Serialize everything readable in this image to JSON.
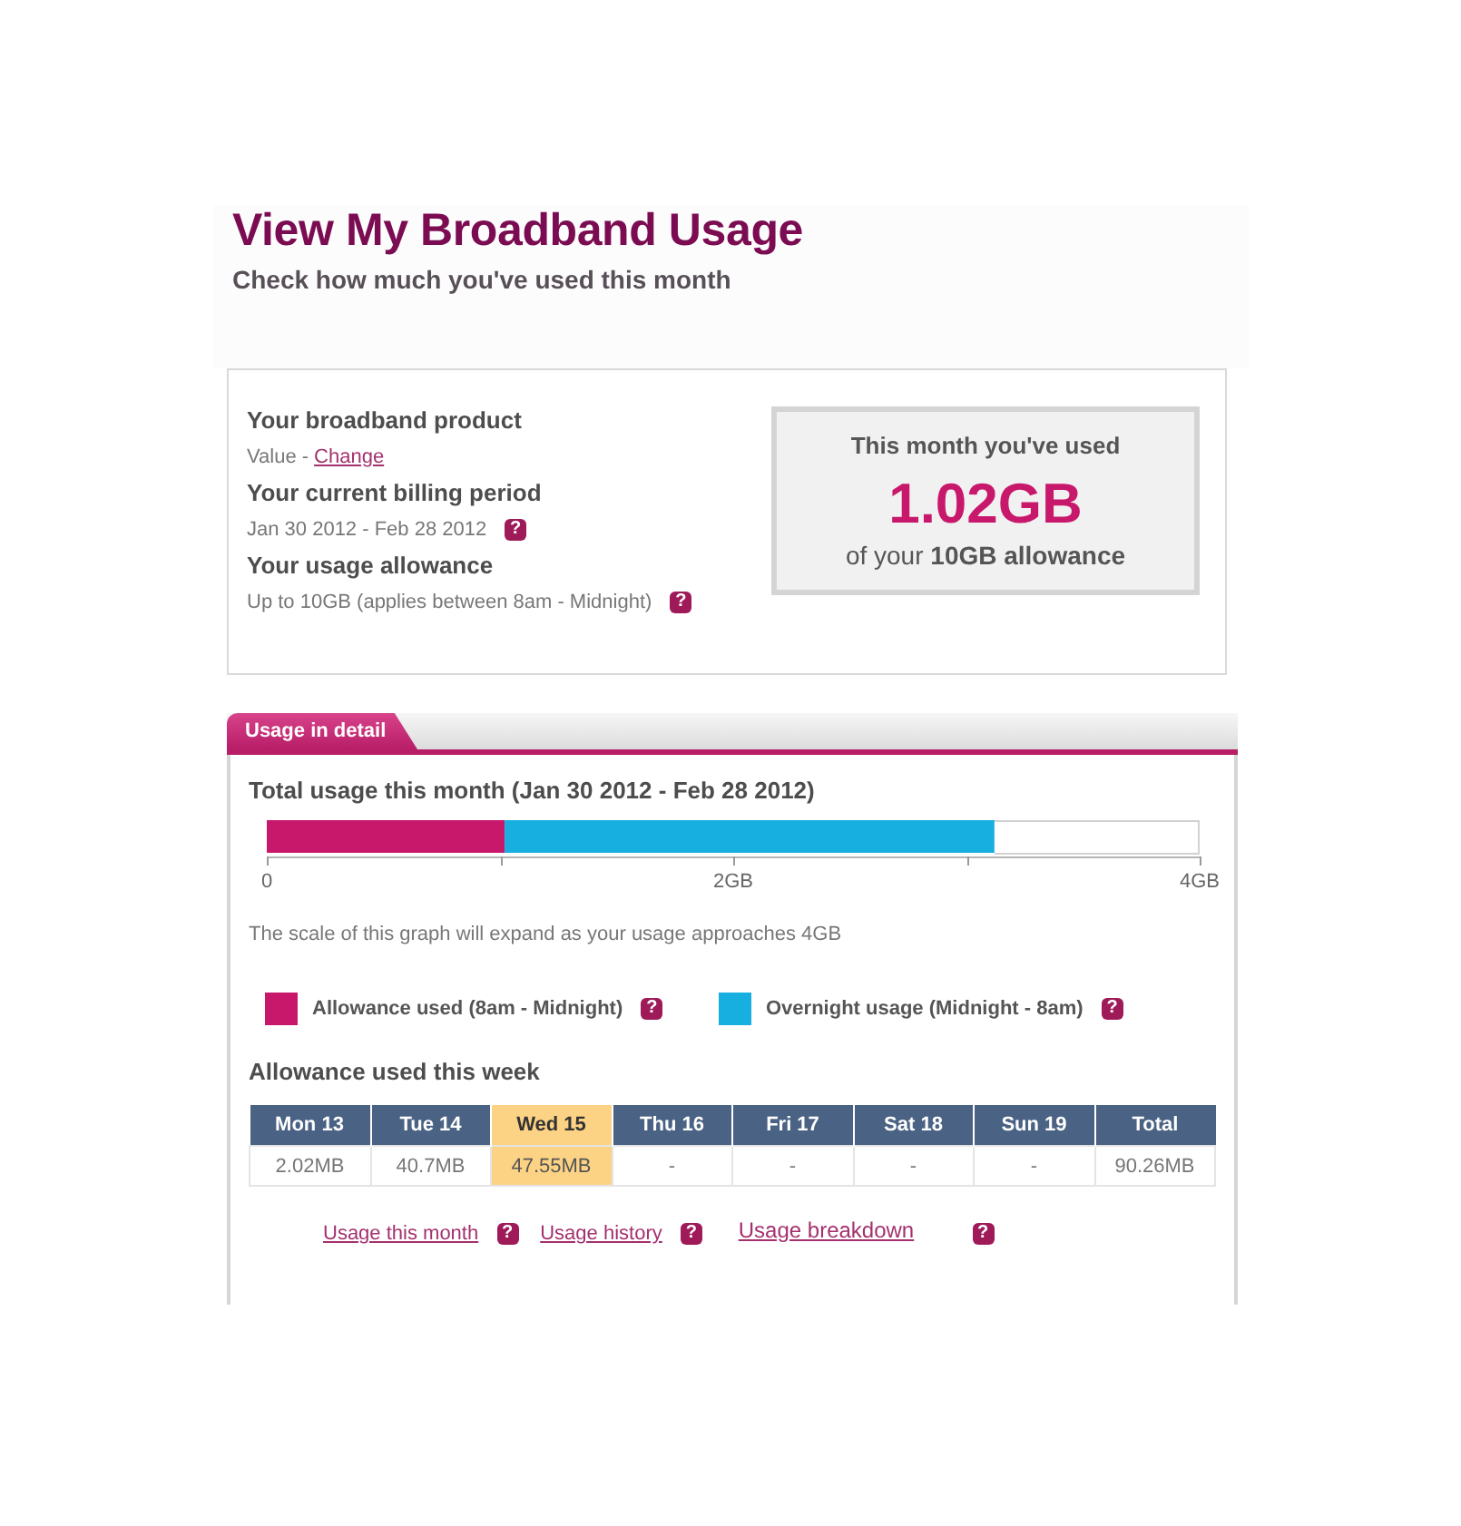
{
  "header": {
    "title": "View My Broadband Usage",
    "subtitle": "Check how much you've used this month"
  },
  "summary": {
    "items": [
      {
        "heading": "Your broadband product",
        "value": "Value -",
        "link": "Change"
      },
      {
        "heading": "Your current billing period",
        "value": "Jan 30 2012 - Feb 28 2012",
        "help": "?"
      },
      {
        "heading": "Your usage allowance",
        "value": "Up to 10GB (applies between 8am - Midnight)",
        "help": "?"
      }
    ],
    "used_box": {
      "caption": "This month you've used",
      "amount": "1.02GB",
      "footnote": "of your **10GB allowance**"
    }
  },
  "detail": {
    "tab": "Usage in detail",
    "chart_title": "Total usage this month (Jan 30 2012 - Feb 28 2012)",
    "chart_data": {
      "type": "bar",
      "orientation": "horizontal",
      "stacked": true,
      "series": [
        {
          "name": "Allowance used (8am - Midnight)",
          "color": "#c8186c",
          "values": [
            1.02
          ]
        },
        {
          "name": "Overnight usage (Midnight - 8am)",
          "color": "#16afe0",
          "values": [
            2.1
          ]
        }
      ],
      "xlim": [
        0,
        4
      ],
      "xticks": [
        {
          "value": 0,
          "label": "0"
        },
        {
          "value": 2,
          "label": "2GB"
        },
        {
          "value": 4,
          "label": "4GB"
        }
      ]
    },
    "note": "The scale of this graph will expand as your usage approaches 4GB",
    "legend_help": [
      "?",
      "?"
    ],
    "week_title": "Allowance used this week",
    "week": [
      {
        "day": "Mon 13",
        "usage": "2.02MB",
        "selected": false
      },
      {
        "day": "Tue 14",
        "usage": "40.7MB",
        "selected": false
      },
      {
        "day": "Wed 15",
        "usage": "47.55MB",
        "selected": true
      },
      {
        "day": "Thu 16",
        "usage": "-",
        "selected": false
      },
      {
        "day": "Fri 17",
        "usage": "-",
        "selected": false
      },
      {
        "day": "Sat 18",
        "usage": "-",
        "selected": false
      },
      {
        "day": "Sun 19",
        "usage": "-",
        "selected": false
      },
      {
        "day": "Total",
        "usage": "90.26MB",
        "selected": false
      }
    ],
    "links": [
      {
        "label": "Usage this month",
        "help": "?"
      },
      {
        "label": "Usage history",
        "help": "?"
      },
      {
        "label": "Usage breakdown",
        "help": "?"
      }
    ]
  }
}
